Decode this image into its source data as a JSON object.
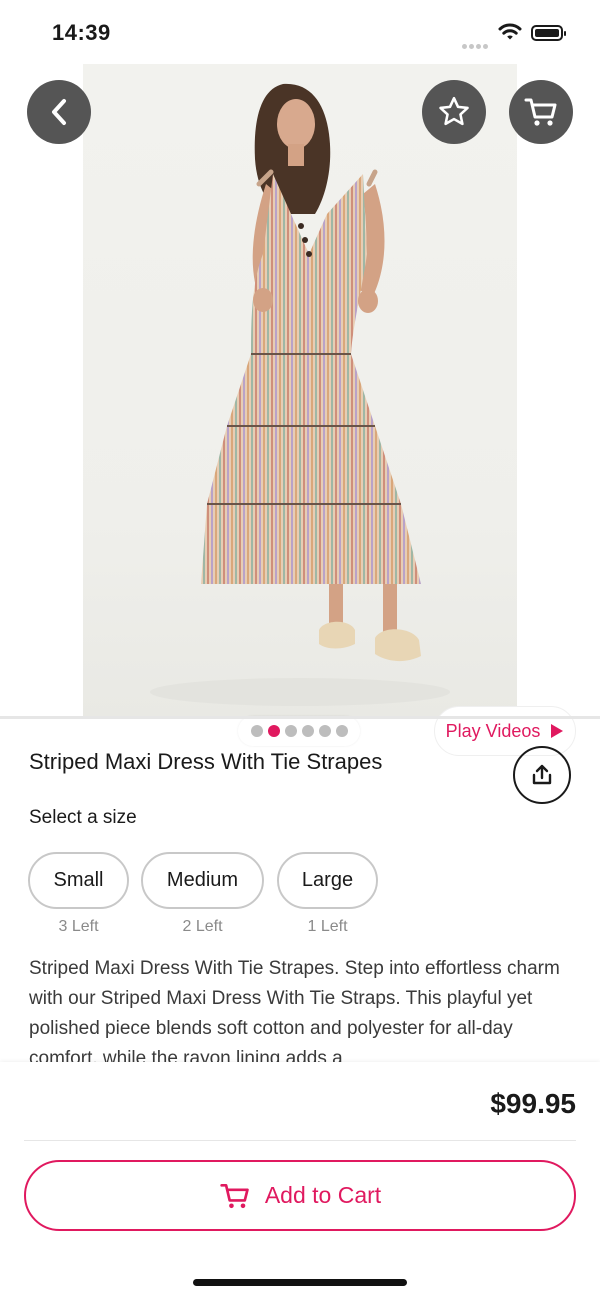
{
  "status_bar": {
    "time": "14:39"
  },
  "product": {
    "title": "Striped Maxi Dress With Tie Strapes",
    "size_label": "Select a size",
    "sizes": [
      {
        "label": "Small",
        "stock": "3 Left"
      },
      {
        "label": "Medium",
        "stock": "2 Left"
      },
      {
        "label": "Large",
        "stock": "1 Left"
      }
    ],
    "description": "Striped Maxi Dress With Tie Strapes. Step into effortless charm with our Striped Maxi Dress With Tie Straps. This playful yet polished piece blends soft cotton and polyester for all-day comfort, while the rayon lining adds a",
    "price": "$99.95"
  },
  "gallery": {
    "play_videos_label": "Play Videos",
    "image_count": 6,
    "active_index": 1
  },
  "actions": {
    "add_to_cart_label": "Add to Cart"
  },
  "icons": [
    "back-icon",
    "star-icon",
    "cart-icon",
    "share-icon",
    "play-icon",
    "wifi-icon",
    "battery-icon"
  ],
  "colors": {
    "accent": "#e0195f",
    "icon_button_bg": "#555555",
    "text": "#1a1a1a",
    "muted": "#8a8a8a"
  }
}
